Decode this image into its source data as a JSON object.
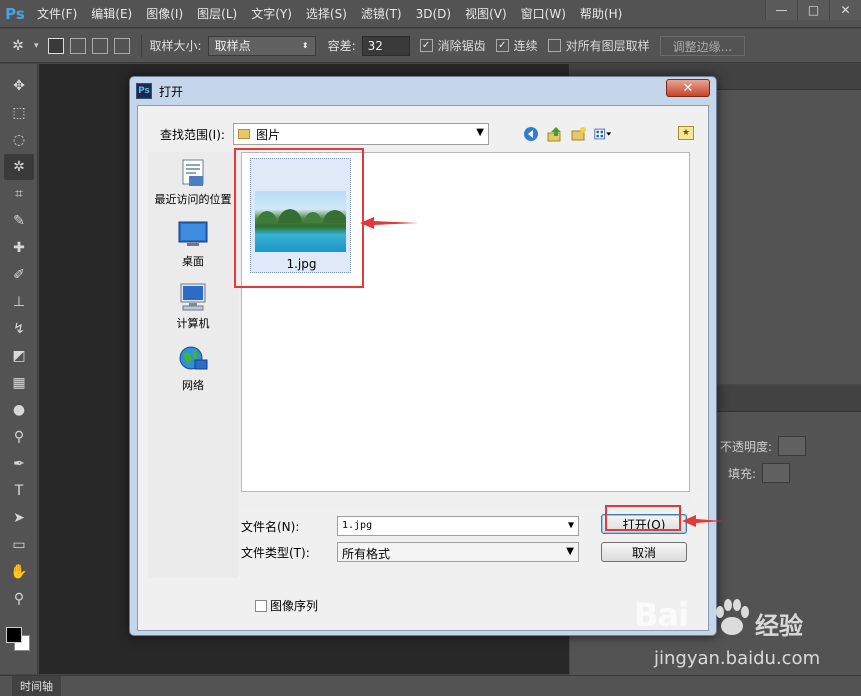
{
  "app": {
    "logo": "Ps",
    "menu": [
      "文件(F)",
      "编辑(E)",
      "图像(I)",
      "图层(L)",
      "文字(Y)",
      "选择(S)",
      "滤镜(T)",
      "3D(D)",
      "视图(V)",
      "窗口(W)",
      "帮助(H)"
    ],
    "window_controls": [
      "—",
      "□",
      "✕"
    ]
  },
  "options_bar": {
    "sample_size_label": "取样大小:",
    "sample_size_value": "取样点",
    "tolerance_label": "容差:",
    "tolerance_value": "32",
    "antialias_label": "消除锯齿",
    "contiguous_label": "连续",
    "all_layers_label": "对所有图层取样",
    "refine_edge_label": "调整边缘..."
  },
  "right_panel": {
    "opacity_label": "不透明度:",
    "fill_label": "填充:"
  },
  "bottom": {
    "timeline_tab": "时间轴"
  },
  "dialog": {
    "title": "打开",
    "look_in_label": "查找范围(I):",
    "look_in_value": "图片",
    "places": [
      "最近访问的位置",
      "桌面",
      "计算机",
      "网络"
    ],
    "files": [
      {
        "name": "1.jpg"
      }
    ],
    "file_name_label": "文件名(N):",
    "file_name_value": "1.jpg",
    "file_type_label": "文件类型(T):",
    "file_type_value": "所有格式",
    "open_button": "打开(O)",
    "cancel_button": "取消",
    "image_sequence_label": "图像序列"
  },
  "watermark": {
    "brand": "Bai",
    "brand_cn": "经验",
    "url": "jingyan.baidu.com"
  },
  "colors": {
    "annotation_red": "#e23a3a",
    "ps_chrome": "#535353",
    "dialog_frame": "#c6d6ea"
  }
}
